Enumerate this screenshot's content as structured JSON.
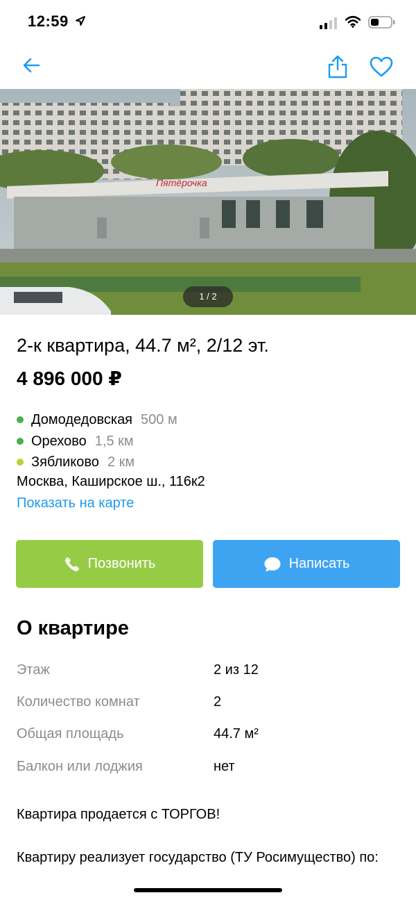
{
  "status_bar": {
    "time": "12:59"
  },
  "photo": {
    "counter": "1 / 2"
  },
  "listing": {
    "title": "2-к квартира, 44.7 м², 2/12 эт.",
    "price": "4 896 000 ₽"
  },
  "metro": [
    {
      "name": "Домодедовская",
      "distance": "500 м",
      "color": "#4caf50"
    },
    {
      "name": "Орехово",
      "distance": "1,5 км",
      "color": "#4caf50"
    },
    {
      "name": "Зябликово",
      "distance": "2 км",
      "color": "#b5d334"
    }
  ],
  "location": {
    "address": "Москва, Каширское ш., 116к2",
    "map_link": "Показать на карте"
  },
  "actions": {
    "call_label": "Позвонить",
    "message_label": "Написать"
  },
  "about": {
    "title": "О квартире",
    "params": [
      {
        "label": "Этаж",
        "value": "2 из 12"
      },
      {
        "label": "Количество комнат",
        "value": "2"
      },
      {
        "label": "Общая площадь",
        "value": "44.7 м²"
      },
      {
        "label": "Балкон или лоджия",
        "value": "нет"
      }
    ]
  },
  "description": {
    "paragraph_1": "Квартира продается с ТОРГОВ!",
    "paragraph_2": "Квартиру реализует государство (ТУ Росимущество) по:"
  },
  "colors": {
    "call_button": "#96cb46",
    "message_button": "#3ea4f2",
    "link": "#1c9bef",
    "nav_icons": "#1c9bef"
  },
  "icons": {
    "back": "back-arrow-icon",
    "share": "share-icon",
    "favorite": "heart-icon",
    "call": "phone-icon",
    "message": "chat-bubble-icon",
    "location": "location-arrow-icon",
    "signal": "signal-icon",
    "wifi": "wifi-icon",
    "battery": "battery-icon"
  }
}
